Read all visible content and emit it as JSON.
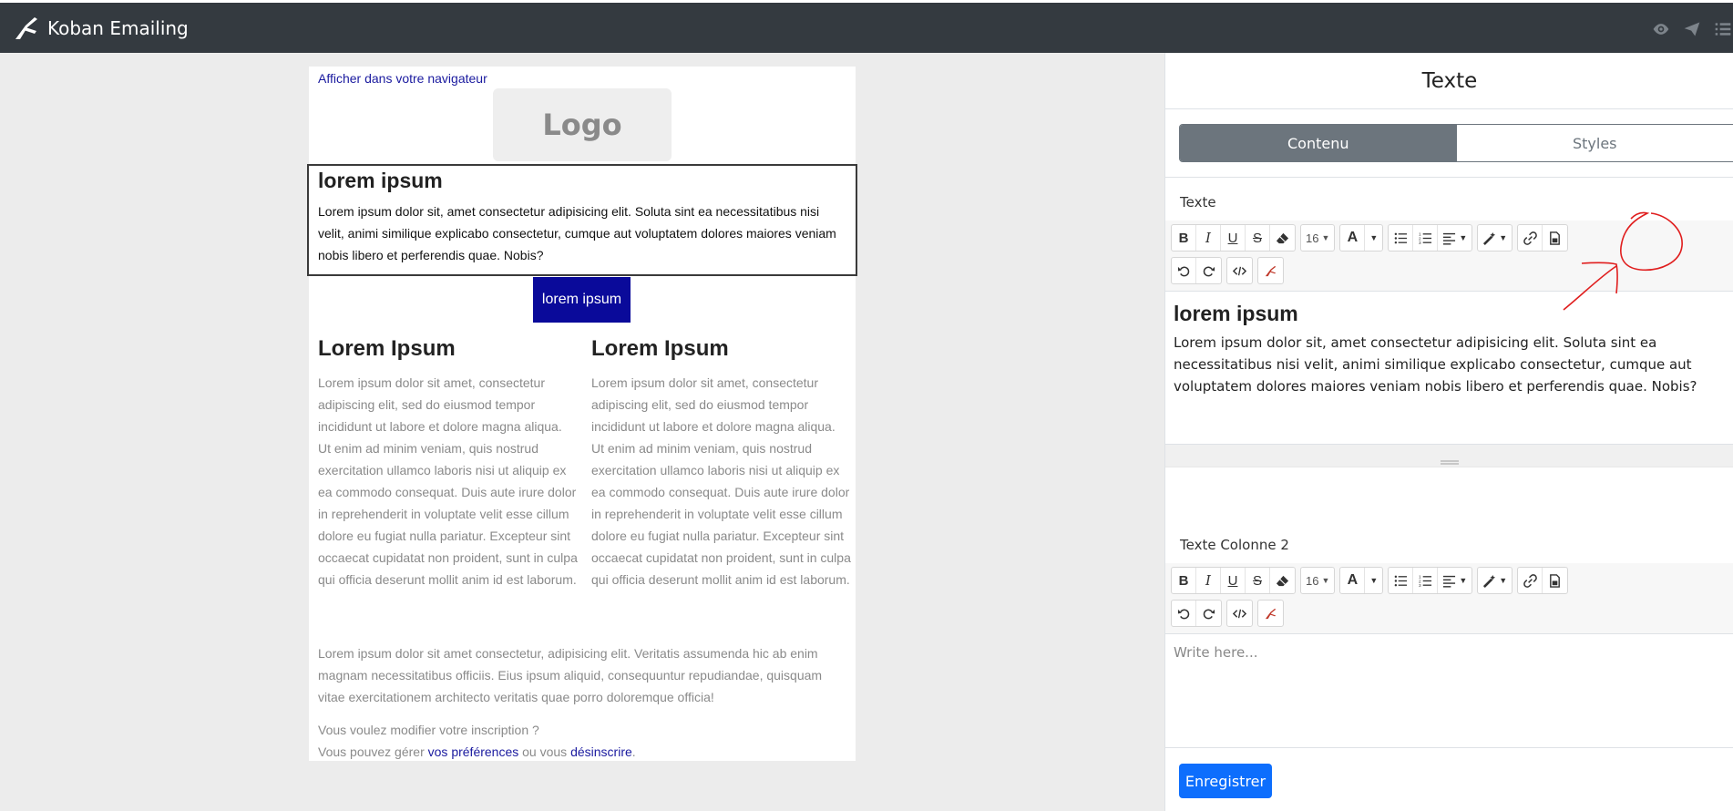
{
  "app": {
    "title": "Koban Emailing"
  },
  "topbar": {
    "icons": [
      "eye-icon",
      "send-icon",
      "list-icon"
    ]
  },
  "email": {
    "view_in_browser": "Afficher dans votre navigateur",
    "logo_text": "Logo",
    "heading": "lorem ipsum",
    "body": "Lorem ipsum dolor sit, amet consectetur adipisicing elit. Soluta sint ea necessitatibus nisi velit, animi similique explicabo consectetur, cumque aut voluptatem dolores maiores veniam nobis libero et perferendis quae. Nobis?",
    "button": "lorem ipsum",
    "col_left": {
      "title": "Lorem Ipsum",
      "text": "Lorem ipsum dolor sit amet, consectetur adipiscing elit, sed do eiusmod tempor incididunt ut labore et dolore magna aliqua. Ut enim ad minim veniam, quis nostrud exercitation ullamco laboris nisi ut aliquip ex ea commodo consequat. Duis aute irure dolor in reprehenderit in voluptate velit esse cillum dolore eu fugiat nulla pariatur. Excepteur sint occaecat cupidatat non proident, sunt in culpa qui officia deserunt mollit anim id est laborum."
    },
    "col_right": {
      "title": "Lorem Ipsum",
      "text": "Lorem ipsum dolor sit amet, consectetur adipiscing elit, sed do eiusmod tempor incididunt ut labore et dolore magna aliqua. Ut enim ad minim veniam, quis nostrud exercitation ullamco laboris nisi ut aliquip ex ea commodo consequat. Duis aute irure dolor in reprehenderit in voluptate velit esse cillum dolore eu fugiat nulla pariatur. Excepteur sint occaecat cupidatat non proident, sunt in culpa qui officia deserunt mollit anim id est laborum."
    },
    "footer_text": "Lorem ipsum dolor sit amet consectetur, adipisicing elit. Veritatis assumenda hic ab enim magnam necessitatibus officiis. Eius ipsum aliquid, consequuntur repudiandae, quisquam vitae exercitationem architecto veritatis quae porro doloremque officia!",
    "footer_question": "Vous voulez modifier votre inscription ?",
    "footer_prefix": "Vous pouvez gérer",
    "footer_link_prefs": "vos préférences",
    "footer_middle": "ou vous",
    "footer_link_unsub": "désinscrire",
    "footer_suffix": "."
  },
  "panel": {
    "title": "Texte",
    "tabs": [
      {
        "label": "Contenu",
        "active": true
      },
      {
        "label": "Styles",
        "active": false
      }
    ],
    "field1": {
      "label": "Texte",
      "font_size": "16",
      "heading": "lorem ipsum",
      "body": "Lorem ipsum dolor sit, amet consectetur adipisicing elit. Soluta sint ea necessitatibus nisi velit, animi similique explicabo consectetur, cumque aut voluptatem dolores maiores veniam nobis libero et perferendis quae. Nobis?"
    },
    "field2": {
      "label": "Texte Colonne 2",
      "font_size": "16",
      "placeholder": "Write here..."
    },
    "save_label": "Enregistrer"
  },
  "colors": {
    "topbar": "#343a40",
    "accent": "#0d6efd",
    "email_button": "#0a0a9a",
    "tab_active": "#6c757d",
    "annotation": "#e01e1e"
  }
}
